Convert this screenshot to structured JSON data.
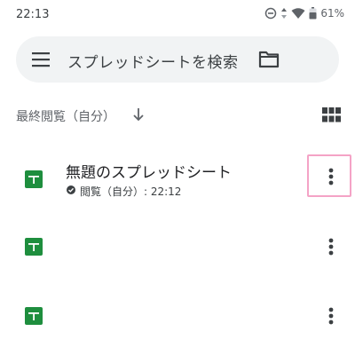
{
  "status_bar": {
    "time": "22:13",
    "battery": "61%"
  },
  "search": {
    "placeholder": "スプレッドシートを検索"
  },
  "sort": {
    "label": "最終閲覧（自分）"
  },
  "files": [
    {
      "title": "無題のスプレッドシート",
      "meta": "閲覧（自分）: 22:12"
    },
    {
      "title": "",
      "meta": ""
    },
    {
      "title": "",
      "meta": ""
    }
  ],
  "colors": {
    "sheet_green": "#1e8e3e",
    "highlight": "#f4a3c6",
    "search_bg": "#f1f3f4"
  },
  "icons": [
    "menu-icon",
    "folder-icon",
    "arrow-down-icon",
    "grid-view-icon",
    "spreadsheet-icon",
    "more-vert-icon",
    "do-not-disturb-icon",
    "wifi-icon",
    "battery-icon",
    "check-circle-icon"
  ]
}
